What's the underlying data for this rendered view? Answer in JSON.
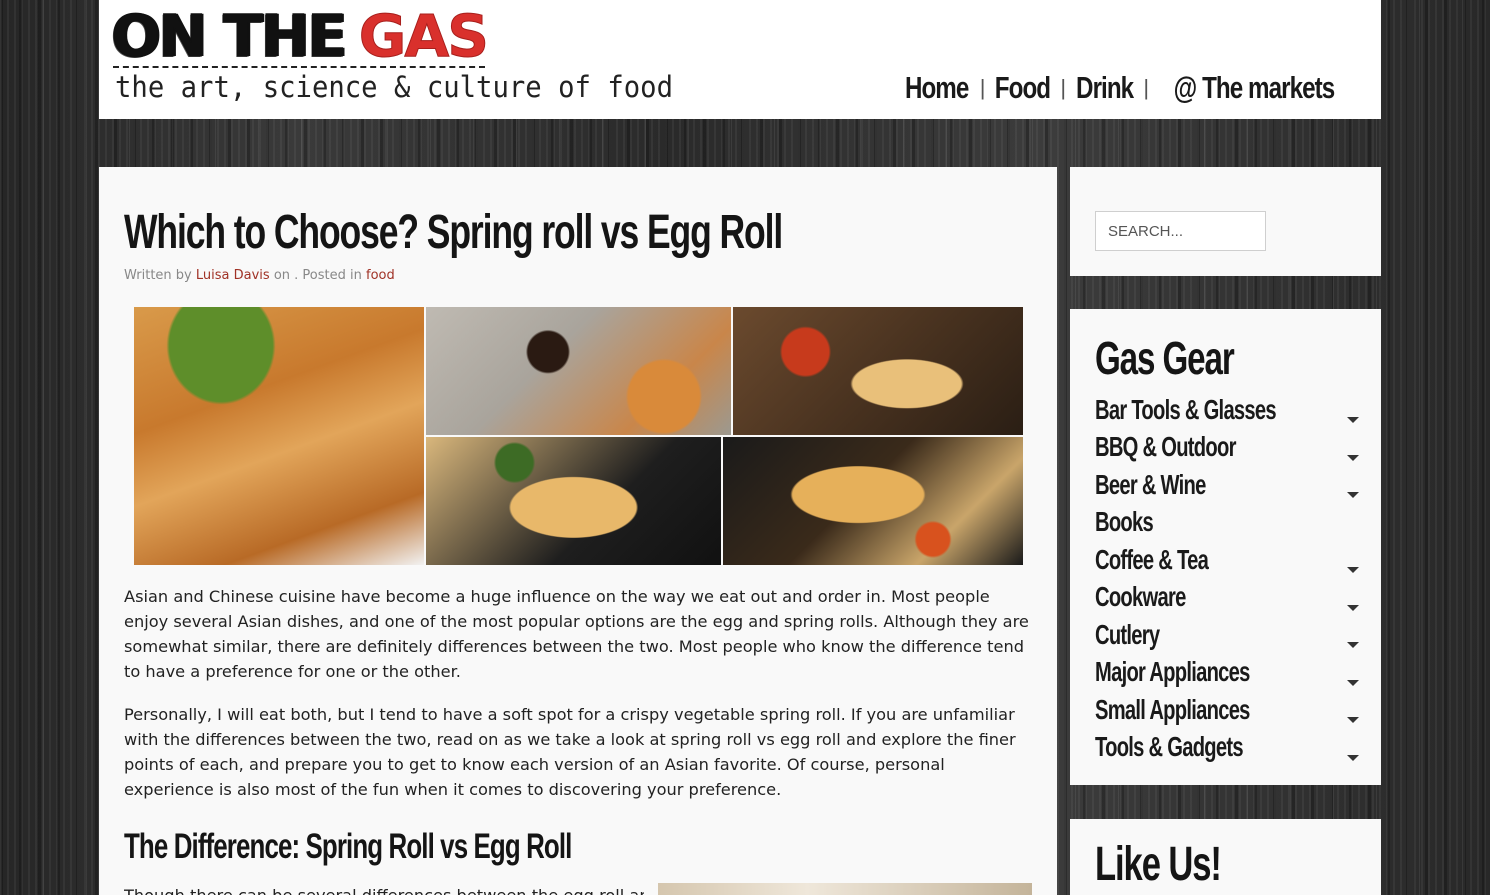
{
  "site": {
    "logo_main": "ON THE",
    "logo_accent": "GAS",
    "tagline": "the art, science & culture of food",
    "accent_color": "#d9302c"
  },
  "nav": {
    "items": [
      "Home",
      "Food",
      "Drink",
      "@ The markets"
    ],
    "separator": "|"
  },
  "article": {
    "title": "Which to Choose? Spring roll vs Egg Roll",
    "byline": {
      "written_by": "Written by",
      "author": "Luisa Davis",
      "on": "on . Posted in",
      "category": "food"
    },
    "paragraphs": [
      "Asian and Chinese cuisine have become a huge influence on the way we eat out and order in. Most people enjoy several Asian dishes, and one of the most popular options are the egg and spring rolls. Although they are somewhat similar, there are definitely differences between the two. Most people who know the difference tend to have a preference for one or the other.",
      "Personally, I will eat both, but I tend to have a soft spot for a crispy vegetable spring roll. If you are unfamiliar with the differences between the two, read on as we take a look at spring roll vs egg roll and explore the finer points of each, and prepare you to get to know each version of an Asian favorite. Of course, personal experience is also most of the fun when it comes to discovering your preference."
    ],
    "section_heading": "The Difference: Spring Roll vs Egg Roll",
    "section_text_start": "Though there can be several differences between the egg roll and"
  },
  "sidebar": {
    "search_placeholder": "SEARCH...",
    "gear_title": "Gas Gear",
    "gear_items": [
      {
        "label": "Bar Tools & Glasses",
        "expandable": true
      },
      {
        "label": "BBQ & Outdoor",
        "expandable": true
      },
      {
        "label": "Beer & Wine",
        "expandable": true
      },
      {
        "label": "Books",
        "expandable": false
      },
      {
        "label": "Coffee & Tea",
        "expandable": true
      },
      {
        "label": "Cookware",
        "expandable": true
      },
      {
        "label": "Cutlery",
        "expandable": true
      },
      {
        "label": "Major Appliances",
        "expandable": true
      },
      {
        "label": "Small Appliances",
        "expandable": true
      },
      {
        "label": "Tools & Gadgets",
        "expandable": true
      }
    ],
    "like_title": "Like Us!"
  }
}
